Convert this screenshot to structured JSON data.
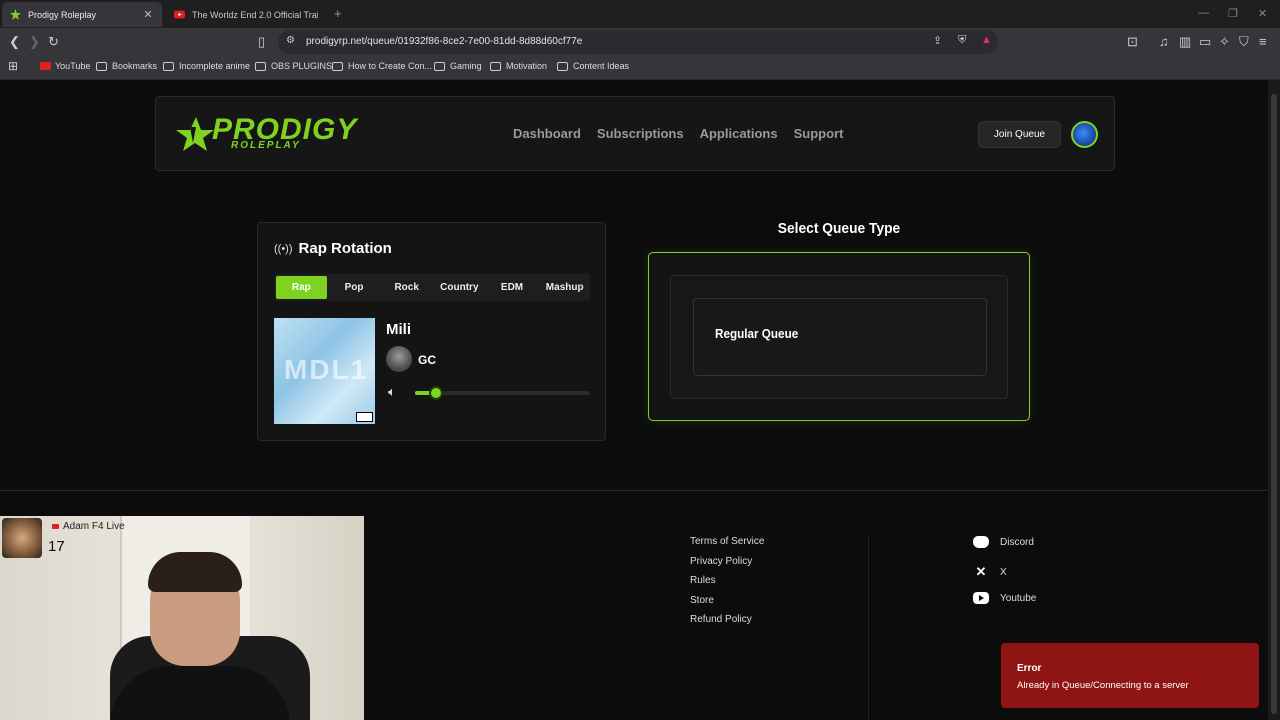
{
  "browser": {
    "tabs": [
      {
        "title": "Prodigy Roleplay",
        "active": true
      },
      {
        "title": "The Worldz End 2.0 Official Trailer 4K",
        "active": false
      }
    ],
    "url": "prodigyrp.net/queue/01932f86-8ce2-7e00-81dd-8d88d60cf77e",
    "bookmarks": [
      "YouTube",
      "Bookmarks",
      "Incomplete anime",
      "OBS PLUGINS",
      "How to Create Con...",
      "Gaming",
      "Motivation",
      "Content Ideas"
    ]
  },
  "site": {
    "logo_main": "PRODIGY",
    "logo_sub": "ROLEPLAY",
    "nav": [
      "Dashboard",
      "Subscriptions",
      "Applications",
      "Support"
    ],
    "join_queue": "Join Queue",
    "accent": "#7ed321"
  },
  "player": {
    "title": "Rap Rotation",
    "genres": [
      "Rap",
      "Pop",
      "Rock",
      "Country",
      "EDM",
      "Mashup"
    ],
    "selected_genre": "Rap",
    "album_art_text": "MDL1",
    "song": "Mili",
    "artist": "GC",
    "volume_fraction": 0.12
  },
  "queue": {
    "heading": "Select Queue Type",
    "options": [
      "Regular Queue"
    ]
  },
  "footer": {
    "links": [
      "Terms of Service",
      "Privacy Policy",
      "Rules",
      "Store",
      "Refund Policy"
    ],
    "social": [
      {
        "label": "Discord",
        "icon": "discord-icon"
      },
      {
        "label": "X",
        "icon": "x-icon"
      },
      {
        "label": "Youtube",
        "icon": "youtube-icon"
      }
    ]
  },
  "toast": {
    "title": "Error",
    "message": "Already in Queue/Connecting to a server",
    "color": "#8f1515"
  },
  "webcam": {
    "streamer": "Adam F4 Live",
    "count": "17"
  }
}
